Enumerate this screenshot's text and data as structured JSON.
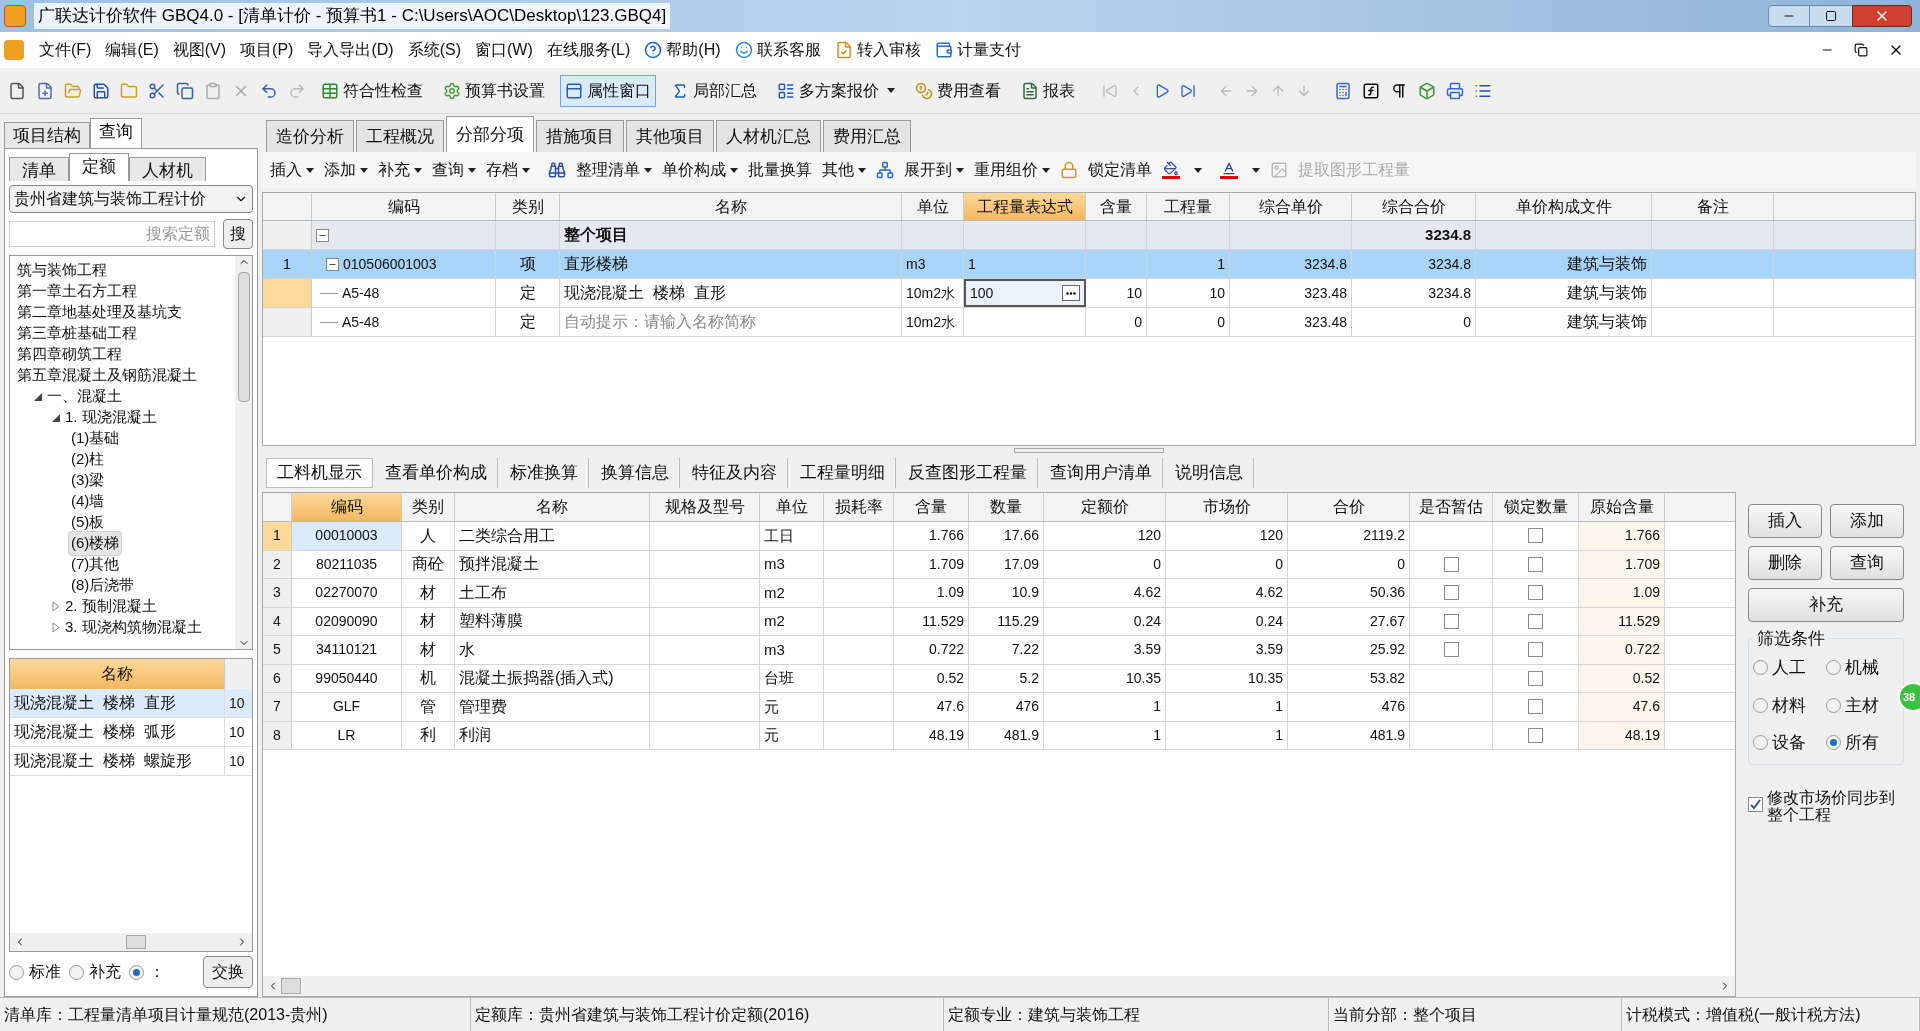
{
  "window": {
    "title": "广联达计价软件 GBQ4.0 - [清单计价 - 预算书1 - C:\\Users\\AOC\\Desktop\\123.GBQ4]"
  },
  "menu": [
    {
      "label": "文件(F)",
      "kind": "plain"
    },
    {
      "label": "编辑(E)",
      "kind": "plain"
    },
    {
      "label": "视图(V)",
      "kind": "plain"
    },
    {
      "label": "项目(P)",
      "kind": "plain"
    },
    {
      "label": "导入导出(D)",
      "kind": "plain"
    },
    {
      "label": "系统(S)",
      "kind": "plain"
    },
    {
      "label": "窗口(W)",
      "kind": "plain"
    },
    {
      "label": "在线服务(L)",
      "kind": "plain"
    },
    {
      "label": "帮助(H)",
      "kind": "help"
    },
    {
      "label": "联系客服",
      "kind": "service"
    },
    {
      "label": "转入审核",
      "kind": "review"
    },
    {
      "label": "计量支付",
      "kind": "payment"
    }
  ],
  "toolbar": [
    {
      "label": "符合性检查",
      "selected": false,
      "dropdown": false
    },
    {
      "label": "预算书设置",
      "selected": false,
      "dropdown": false
    },
    {
      "label": "属性窗口",
      "selected": true,
      "dropdown": false
    },
    {
      "label": "局部汇总",
      "selected": false,
      "dropdown": false
    },
    {
      "label": "多方案报价",
      "selected": false,
      "dropdown": true
    },
    {
      "label": "费用查看",
      "selected": false,
      "dropdown": false
    },
    {
      "label": "报表",
      "selected": false,
      "dropdown": false
    }
  ],
  "left_panel": {
    "tabs": [
      {
        "label": "项目结构",
        "selected": false
      },
      {
        "label": "查询",
        "selected": true
      }
    ],
    "sub_tabs": [
      {
        "label": "清单",
        "selected": false
      },
      {
        "label": "定额",
        "selected": true
      },
      {
        "label": "人材机",
        "selected": false
      }
    ],
    "library_select": "贵州省建筑与装饰工程计价",
    "search": {
      "placeholder": "搜索定额"
    },
    "search_button": "搜",
    "tree": [
      {
        "label": "筑与装饰工程"
      },
      {
        "label": "第一章土石方工程"
      },
      {
        "label": "第二章地基处理及基坑支"
      },
      {
        "label": "第三章桩基础工程"
      },
      {
        "label": "第四章砌筑工程"
      },
      {
        "label": "第五章混凝土及钢筋混凝土",
        "children": [
          {
            "label": "一、混凝土",
            "expanded": true,
            "children": [
              {
                "label": "1. 现浇混凝土",
                "expanded": true,
                "children": [
                  {
                    "label": "(1)基础",
                    "selected": false
                  },
                  {
                    "label": "(2)柱",
                    "selected": false
                  },
                  {
                    "label": "(3)梁",
                    "selected": false
                  },
                  {
                    "label": "(4)墙",
                    "selected": false
                  },
                  {
                    "label": "(5)板",
                    "selected": false
                  },
                  {
                    "label": "(6)楼梯",
                    "selected": true
                  },
                  {
                    "label": "(7)其他",
                    "selected": false
                  },
                  {
                    "label": "(8)后浇带",
                    "selected": false
                  }
                ]
              },
              {
                "label": "2. 预制混凝土",
                "expanded": false
              },
              {
                "label": "3. 现浇构筑物混凝土",
                "expanded": false
              }
            ]
          }
        ]
      }
    ],
    "list_header": "名称",
    "list_rows": [
      {
        "name": "现浇混凝土  楼梯  直形",
        "unit": "10",
        "selected": true
      },
      {
        "name": "现浇混凝土  楼梯  弧形",
        "unit": "10",
        "selected": false
      },
      {
        "name": "现浇混凝土  楼梯  螺旋形",
        "unit": "10",
        "selected": false
      }
    ],
    "radios": [
      {
        "label": "标准",
        "selected": false
      },
      {
        "label": "补充",
        "selected": false
      },
      {
        "label": "：",
        "selected": true
      }
    ],
    "swap_button": "交换"
  },
  "main_tabs": [
    {
      "label": "造价分析",
      "selected": false
    },
    {
      "label": "工程概况",
      "selected": false
    },
    {
      "label": "分部分项",
      "selected": true
    },
    {
      "label": "措施项目",
      "selected": false
    },
    {
      "label": "其他项目",
      "selected": false
    },
    {
      "label": "人材机汇总",
      "selected": false
    },
    {
      "label": "费用汇总",
      "selected": false
    }
  ],
  "sub_toolbar": [
    {
      "label": "插入",
      "dropdown": true,
      "disabled": false
    },
    {
      "label": "添加",
      "dropdown": true,
      "disabled": false
    },
    {
      "label": "补充",
      "dropdown": true,
      "disabled": false
    },
    {
      "label": "查询",
      "dropdown": true,
      "disabled": false
    },
    {
      "label": "存档",
      "dropdown": true,
      "disabled": false
    },
    {
      "label": "整理清单",
      "dropdown": true,
      "disabled": false
    },
    {
      "label": "单价构成",
      "dropdown": true,
      "disabled": false
    },
    {
      "label": "批量换算",
      "dropdown": false,
      "disabled": false
    },
    {
      "label": "其他",
      "dropdown": true,
      "disabled": false
    },
    {
      "label": "展开到",
      "dropdown": true,
      "disabled": false
    },
    {
      "label": "重用组价",
      "dropdown": true,
      "disabled": false
    },
    {
      "label": "锁定清单",
      "dropdown": false,
      "disabled": false
    },
    {
      "label": "提取图形工程量",
      "dropdown": false,
      "disabled": true
    }
  ],
  "bill_table": {
    "columns": [
      {
        "label": "编码",
        "selected": false
      },
      {
        "label": "类别",
        "selected": false
      },
      {
        "label": "名称",
        "selected": false
      },
      {
        "label": "单位",
        "selected": false
      },
      {
        "label": "工程量表达式",
        "selected": true
      },
      {
        "label": "含量",
        "selected": false
      },
      {
        "label": "工程量",
        "selected": false
      },
      {
        "label": "综合单价",
        "selected": false
      },
      {
        "label": "综合合价",
        "selected": false
      },
      {
        "label": "单价构成文件",
        "selected": false
      },
      {
        "label": "备注",
        "selected": false
      }
    ],
    "rows": [
      {
        "kind": "section",
        "name": "整个项目",
        "total": "3234.8",
        "expanded": true,
        "selected": false
      },
      {
        "kind": "bill",
        "num": "1",
        "code": "010506001003",
        "type": "项",
        "name": "直形楼梯",
        "unit": "m3",
        "expr": "1",
        "qty": "1",
        "unit_price": "3234.8",
        "total": "3234.8",
        "file": "建筑与装饰",
        "expanded": true,
        "selected": true
      },
      {
        "kind": "quota",
        "code": "A5-48",
        "type": "定",
        "name": "现浇混凝土  楼梯  直形",
        "unit": "10m2水",
        "expr": "100",
        "content": "10",
        "qty": "10",
        "unit_price": "323.48",
        "total": "3234.8",
        "file": "建筑与装饰",
        "selected": false,
        "editing": true
      },
      {
        "kind": "quota",
        "code": "A5-48",
        "type": "定",
        "placeholder": "自动提示：请输入名称简称",
        "unit": "10m2水",
        "content": "0",
        "qty": "0",
        "unit_price": "323.48",
        "total": "0",
        "file": "建筑与装饰",
        "selected": false,
        "editing": false
      }
    ]
  },
  "detail_tabs": [
    {
      "label": "工料机显示",
      "selected": true
    },
    {
      "label": "查看单价构成",
      "selected": false
    },
    {
      "label": "标准换算",
      "selected": false
    },
    {
      "label": "换算信息",
      "selected": false
    },
    {
      "label": "特征及内容",
      "selected": false
    },
    {
      "label": "工程量明细",
      "selected": false
    },
    {
      "label": "反查图形工程量",
      "selected": false
    },
    {
      "label": "查询用户清单",
      "selected": false
    },
    {
      "label": "说明信息",
      "selected": false
    }
  ],
  "resource_table": {
    "columns": [
      {
        "label": "编码",
        "selected": true
      },
      {
        "label": "类别",
        "selected": false
      },
      {
        "label": "名称",
        "selected": false
      },
      {
        "label": "规格及型号",
        "selected": false
      },
      {
        "label": "单位",
        "selected": false
      },
      {
        "label": "损耗率",
        "selected": false
      },
      {
        "label": "含量",
        "selected": false
      },
      {
        "label": "数量",
        "selected": false
      },
      {
        "label": "定额价",
        "selected": false
      },
      {
        "label": "市场价",
        "selected": false
      },
      {
        "label": "合价",
        "selected": false
      },
      {
        "label": "是否暂估",
        "selected": false
      },
      {
        "label": "锁定数量",
        "selected": false
      },
      {
        "label": "原始含量",
        "selected": false
      }
    ],
    "rows": [
      {
        "num": "1",
        "code": "00010003",
        "type": "人",
        "name": "二类综合用工",
        "unit": "工日",
        "content": "1.766",
        "qty": "17.66",
        "quota_price": "120",
        "market_price": "120",
        "total": "2119.2",
        "locked": false,
        "original": "1.766",
        "selected": true
      },
      {
        "num": "2",
        "code": "80211035",
        "type": "商砼",
        "name": "预拌混凝土",
        "unit": "m3",
        "content": "1.709",
        "qty": "17.09",
        "quota_price": "0",
        "market_price": "0",
        "total": "0",
        "provisional": false,
        "locked": false,
        "original": "1.709",
        "selected": false
      },
      {
        "num": "3",
        "code": "02270070",
        "type": "材",
        "name": "土工布",
        "unit": "m2",
        "content": "1.09",
        "qty": "10.9",
        "quota_price": "4.62",
        "market_price": "4.62",
        "total": "50.36",
        "provisional": false,
        "locked": false,
        "original": "1.09",
        "selected": false
      },
      {
        "num": "4",
        "code": "02090090",
        "type": "材",
        "name": "塑料薄膜",
        "unit": "m2",
        "content": "11.529",
        "qty": "115.29",
        "quota_price": "0.24",
        "market_price": "0.24",
        "total": "27.67",
        "provisional": false,
        "locked": false,
        "original": "11.529",
        "selected": false
      },
      {
        "num": "5",
        "code": "34110121",
        "type": "材",
        "name": "水",
        "unit": "m3",
        "content": "0.722",
        "qty": "7.22",
        "quota_price": "3.59",
        "market_price": "3.59",
        "total": "25.92",
        "provisional": false,
        "locked": false,
        "original": "0.722",
        "selected": false
      },
      {
        "num": "6",
        "code": "99050440",
        "type": "机",
        "name": "混凝土振捣器(插入式)",
        "unit": "台班",
        "content": "0.52",
        "qty": "5.2",
        "quota_price": "10.35",
        "market_price": "10.35",
        "total": "53.82",
        "locked": false,
        "original": "0.52",
        "selected": false
      },
      {
        "num": "7",
        "code": "GLF",
        "type": "管",
        "name": "管理费",
        "unit": "元",
        "content": "47.6",
        "qty": "476",
        "quota_price": "1",
        "market_price": "1",
        "total": "476",
        "locked": false,
        "original": "47.6",
        "selected": false
      },
      {
        "num": "8",
        "code": "LR",
        "type": "利",
        "name": "利润",
        "unit": "元",
        "content": "48.19",
        "qty": "481.9",
        "quota_price": "1",
        "market_price": "1",
        "total": "481.9",
        "locked": false,
        "original": "48.19",
        "selected": false
      }
    ]
  },
  "side_buttons": [
    "插入",
    "添加",
    "删除",
    "查询",
    "补充"
  ],
  "filter": {
    "title": "筛选条件",
    "options": [
      {
        "label": "人工",
        "selected": false
      },
      {
        "label": "机械",
        "selected": false
      },
      {
        "label": "材料",
        "selected": false
      },
      {
        "label": "主材",
        "selected": false
      },
      {
        "label": "设备",
        "selected": false
      },
      {
        "label": "所有",
        "selected": true
      }
    ]
  },
  "sync_option": {
    "label": "修改市场价同步到整个工程",
    "checked": true
  },
  "floating_badge": "38",
  "status_bar": [
    "清单库：工程量清单项目计量规范(2013-贵州)",
    "定额库：贵州省建筑与装饰工程计价定额(2016)",
    "定额专业：建筑与装饰工程",
    "当前分部：整个项目",
    "计税模式：增值税(一般计税方法)"
  ]
}
